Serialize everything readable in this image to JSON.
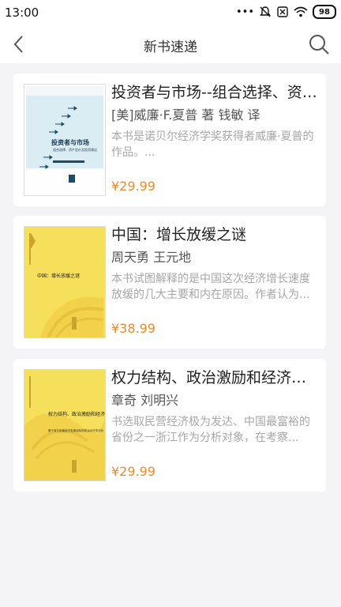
{
  "status": {
    "time": "13:00",
    "battery": "98"
  },
  "nav": {
    "title": "新书速递"
  },
  "books": [
    {
      "title": "投资者与市场--组合选择、资产定价及投资建议",
      "author": "[美]威廉·F.夏普 著 钱敏 译",
      "desc": "本书是诺贝尔经济学奖获得者威廉·夏普的作品。...",
      "price": "¥29.99",
      "cover_title": "投资者与市场",
      "cover_sub": "组合选择、资产定价及投资建议"
    },
    {
      "title": "中国：增长放缓之谜",
      "author": "周天勇 王元地",
      "desc": "本书试图解释的是中国这次经济增长速度放缓的几大主要和内在原因。作者认为...",
      "price": "¥38.99",
      "cover_title": "中国：增长放缓之谜"
    },
    {
      "title": "权力结构、政治激励和经济增长",
      "author": "章奇 刘明兴",
      "desc": "书选取民营经济极为发达、中国最富裕的省份之一浙江作为分析对象，在考察...",
      "price": "¥29.99",
      "cover_title": "权力结构、政治激励和经济增长",
      "cover_sub": "基于浙江民营经济发展经验的政治经济学分析"
    }
  ]
}
